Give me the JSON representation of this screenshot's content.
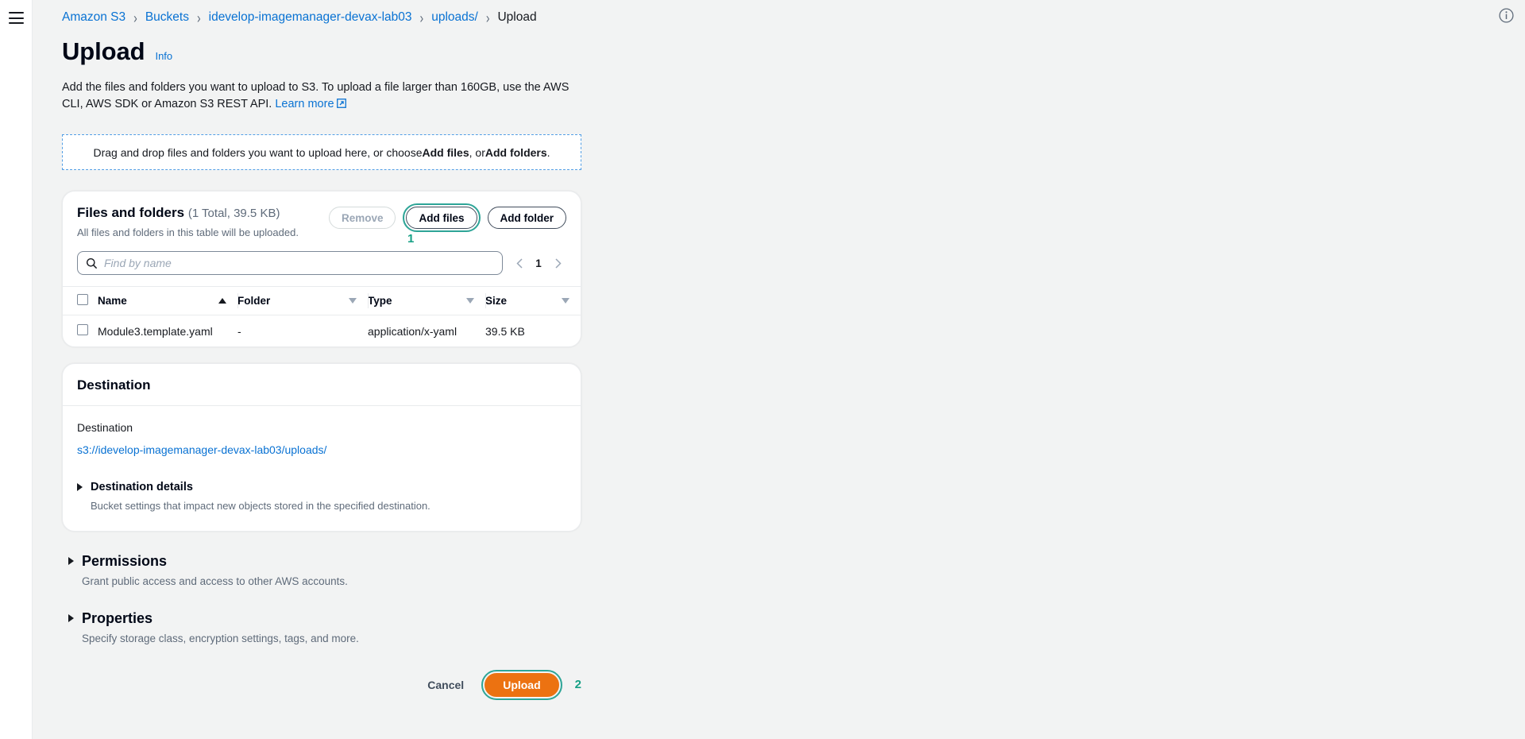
{
  "nav": {
    "menu_icon": "hamburger-menu-icon",
    "info_icon": "info-circle-icon"
  },
  "breadcrumb": {
    "items": [
      {
        "label": "Amazon S3",
        "current": false
      },
      {
        "label": "Buckets",
        "current": false
      },
      {
        "label": "idevelop-imagemanager-devax-lab03",
        "current": false
      },
      {
        "label": "uploads/",
        "current": false
      },
      {
        "label": "Upload",
        "current": true
      }
    ],
    "separator": "›"
  },
  "header": {
    "title": "Upload",
    "info_label": "Info",
    "description_part1": "Add the files and folders you want to upload to S3. To upload a file larger than 160GB, use the AWS CLI, AWS SDK or Amazon S3 REST API. ",
    "learn_more_label": "Learn more"
  },
  "dropzone": {
    "text_before": "Drag and drop files and folders you want to upload here, or choose ",
    "bold_1": "Add files",
    "text_middle": ", or ",
    "bold_2": "Add folders",
    "text_after": "."
  },
  "files_panel": {
    "title": "Files and folders",
    "counter": "(1 Total, 39.5 KB)",
    "subtitle": "All files and folders in this table will be uploaded.",
    "remove_label": "Remove",
    "add_files_label": "Add files",
    "add_folder_label": "Add folder",
    "annotation_1": "1",
    "search_placeholder": "Find by name",
    "search_value": "",
    "search_icon": "search-icon",
    "pagination": {
      "prev_icon": "chevron-left-icon",
      "current_page": "1",
      "next_icon": "chevron-right-icon"
    },
    "columns": [
      {
        "label": "Name",
        "sort": "asc"
      },
      {
        "label": "Folder",
        "sort": "none"
      },
      {
        "label": "Type",
        "sort": "none"
      },
      {
        "label": "Size",
        "sort": "none"
      }
    ],
    "rows": [
      {
        "name": "Module3.template.yaml",
        "folder": "-",
        "type": "application/x-yaml",
        "size": "39.5 KB"
      }
    ]
  },
  "destination": {
    "card_title": "Destination",
    "field_label": "Destination",
    "uri": "s3://idevelop-imagemanager-devax-lab03/uploads/",
    "details_title": "Destination details",
    "details_desc": "Bucket settings that impact new objects stored in the specified destination."
  },
  "permissions": {
    "title": "Permissions",
    "desc": "Grant public access and access to other AWS accounts."
  },
  "properties": {
    "title": "Properties",
    "desc": "Specify storage class, encryption settings, tags, and more."
  },
  "footer": {
    "cancel_label": "Cancel",
    "upload_label": "Upload",
    "annotation_2": "2"
  },
  "colors": {
    "link": "#0972d3",
    "accent_orange": "#ec7211",
    "focus_teal": "#2ea597",
    "annotation_teal": "#16a085",
    "page_bg": "#f2f3f3"
  }
}
